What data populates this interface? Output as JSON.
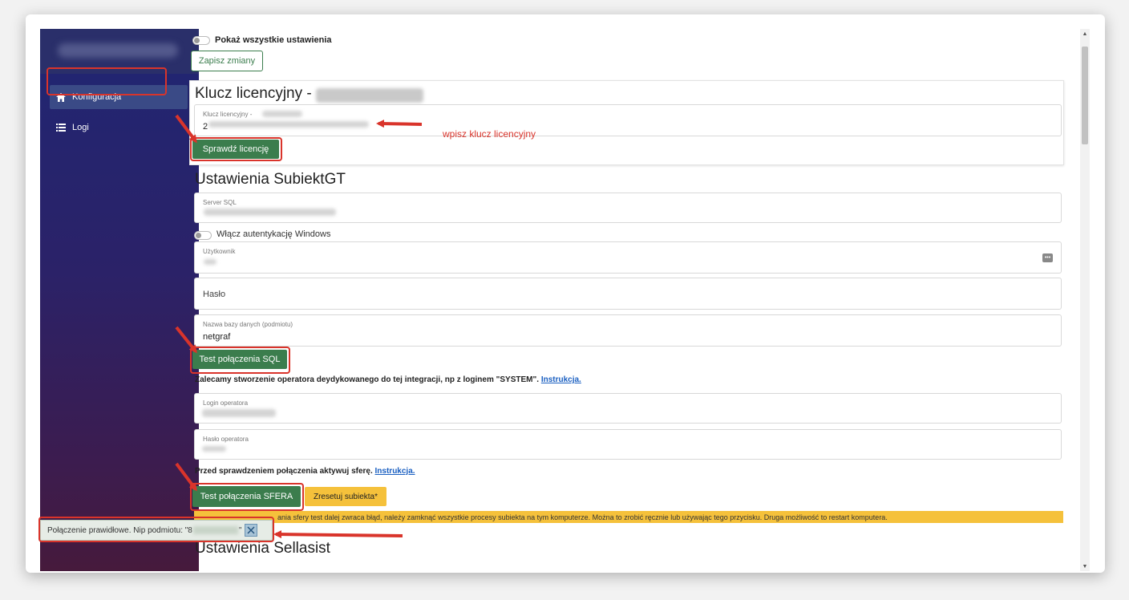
{
  "sidebar": {
    "items": [
      {
        "label": "Konfiguracja",
        "icon": "home-icon"
      },
      {
        "label": "Logi",
        "icon": "list-icon"
      }
    ]
  },
  "top": {
    "show_all_label": "Pokaż wszystkie ustawienia",
    "save_label": "Zapisz zmiany"
  },
  "license": {
    "title": "Klucz licencyjny -",
    "field_label": "Klucz licencyjny -",
    "field_value_prefix": "2",
    "check_button": "Sprawdź licencję",
    "annotation": "wpisz klucz licencyjny"
  },
  "subiekt": {
    "title": "Ustawienia SubiektGT",
    "server_label": "Server SQL",
    "windows_auth_label": "Włącz autentykację Windows",
    "user_label": "Użytkownik",
    "password_placeholder": "Hasło",
    "db_label": "Nazwa bazy danych (podmiotu)",
    "db_value": "netgraf",
    "test_sql_button": "Test połączenia SQL",
    "recommend_text": "Zalecamy stworzenie operatora deydykowanego do tej integracji, np z loginem \"SYSTEM\".",
    "recommend_link": "Instrukcja.",
    "operator_login_label": "Login operatora",
    "operator_password_label": "Hasło operatora",
    "sfera_info_text": "Przed sprawdzeniem połączenia aktywuj sferę.",
    "sfera_info_link": "Instrukcja.",
    "test_sfera_button": "Test połączenia SFERA",
    "reset_button": "Zresetuj subiekta*",
    "warning_text": "ania sfery test dalej zwraca błąd, należy zamknąć wszystkie procesy subiekta na tym komputerze. Można to zrobić ręcznie lub używając tego przycisku. Druga możliwość to restart komputera."
  },
  "sellasist": {
    "title": "Ustawienia Sellasist"
  },
  "toast": {
    "message": "Połączenie prawidłowe. Nip podmiotu: \"8",
    "message_end": "\""
  },
  "colors": {
    "accent_green": "#3b7d4d",
    "annotation_red": "#d9342b",
    "warning_yellow": "#f5c13b",
    "link_blue": "#1a5fc1"
  }
}
